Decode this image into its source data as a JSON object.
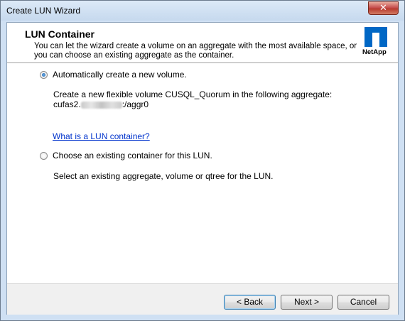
{
  "window": {
    "title": "Create LUN Wizard",
    "close_label": "✕"
  },
  "header": {
    "title": "LUN Container",
    "description": "You can let the wizard create a volume on an aggregate with the most available space, or you can choose an existing aggregate as the container.",
    "logo_text": "NetApp",
    "brand_color": "#0067c5"
  },
  "options": {
    "auto": {
      "label": "Automatically create a new volume.",
      "selected": true,
      "detail_line1": "Create a new flexible volume CUSQL_Quorum in the following aggregate:",
      "aggregate_prefix": "cufas2.",
      "aggregate_suffix": ":/aggr0"
    },
    "help_link": "What is a LUN container?",
    "existing": {
      "label": "Choose an existing container for this LUN.",
      "selected": false,
      "detail": "Select an existing aggregate, volume or qtree for the LUN."
    }
  },
  "footer": {
    "back": "< Back",
    "next": "Next >",
    "cancel": "Cancel"
  }
}
